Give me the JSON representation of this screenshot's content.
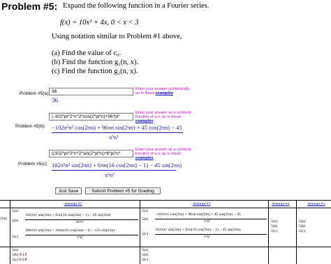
{
  "problem": {
    "title": "Problem #5:",
    "prompt": "Expand the following function in a Fourier series.",
    "function": "f(x) = 10x² + 4x,  0 < x < 3",
    "notation": "Using notation similar to Problem #1 above,",
    "part_a": "(a)  Find the value of c₀.",
    "part_b": "(b)  Find the function g₁(n, x).",
    "part_c": "(c)  Find the function g₂(n, x)."
  },
  "answers": {
    "a": {
      "label": "Problem #5(a):",
      "value": "36",
      "preview": "36",
      "hint1": "Enter your answer symbolically,",
      "hint2": "as in these",
      "hint_link": "examples"
    },
    "b": {
      "label": "Problem #5(b):",
      "value": "(-102*pi^2*n^2*cos(2*pi*n)+96*pi*",
      "preview_num": "−102π²n² cos(2πn) + 96πn sin(2πn) + 45 cos(2πn) − 45",
      "preview_den": "π³n³",
      "hint1": "Enter your answer as a symbolic",
      "hint2": "function of x,n, as in these",
      "hint_link": "examples"
    },
    "c": {
      "label": "Problem #5(c):",
      "value": "((102*pi^2*n^2*sin(2*pi*n)+6*pi*n*",
      "preview_num": "102π²n² sin(2πn) + 6πn(16 cos(2πn) − 1) − 45 sin(2πn)",
      "preview_den": "π³n³",
      "hint1": "Enter your answer as a symbolic",
      "hint2": "function of x,n, as in these",
      "hint_link": "examples"
    }
  },
  "buttons": {
    "save": "Just Save",
    "submit": "Submit Problem #5 for Grading"
  },
  "attempts": {
    "headers": [
      "Attempt #2",
      "Attempt #3",
      "Attempt #4",
      "Attempt #5"
    ],
    "left_partial": "2πn)",
    "col0": [
      "5(a)",
      "5(b)",
      "5(c)",
      "5(a)",
      "5(b) 0/1",
      "5(c) 0/2"
    ],
    "col0_marks": [
      "✗",
      "✗"
    ],
    "att2_b_num": "102π²n² sin(2πn) + 6πn(16 cos(2πn) − 1) − 45 sin(2πn)",
    "att2_b_den": "3π³n³",
    "att2_c_num": "306π²n² sin(2πn) + 18πn(16 cos(2πn) − 1) − 135 sin(2πn)",
    "att2_c_den": "π³n³",
    "att3_labels": [
      "5(a)",
      "5(b)",
      "5(c)",
      "5(a)",
      "5(b)",
      "5(c)"
    ],
    "att3_b_num": "−102π²n² cos(2πn) + 96πn sin(2πn) + 45 cos(2πn) − 45",
    "att3_b_den": "π³n³",
    "att3_c_num": "102π²n² sin(2πn) + 6πn(16 cos(2πn) − 1) − 45 sin(2πn)",
    "att3_c_den": "π³n³",
    "att4_labels": [
      "5(a)",
      "5(b)",
      "5(c)"
    ],
    "att5_labels": [
      "5(a)",
      "5(b)",
      "5(c)"
    ]
  }
}
